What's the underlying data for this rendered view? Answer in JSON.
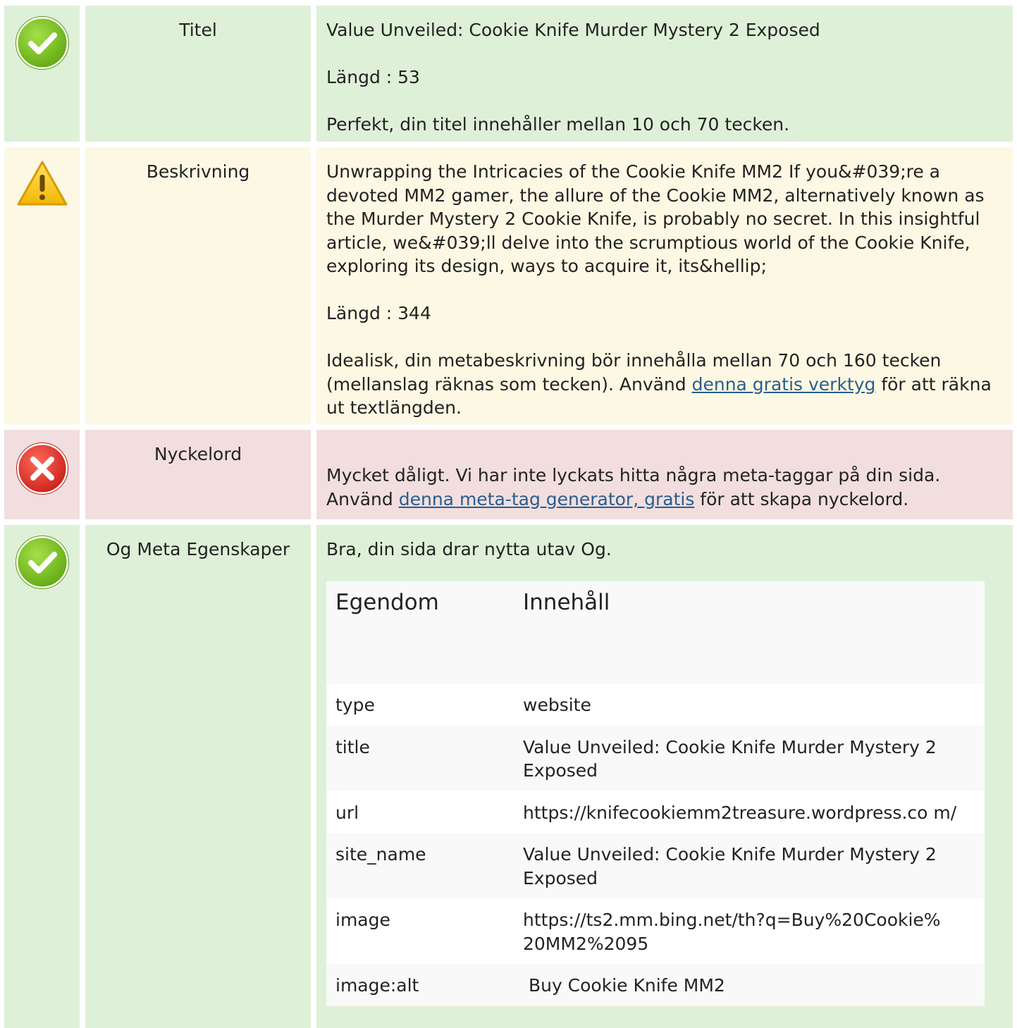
{
  "sections": {
    "title": {
      "label": "Titel",
      "text": "Value Unveiled: Cookie Knife Murder Mystery 2 Exposed",
      "length": "Längd : 53",
      "message": "Perfekt, din titel innehåller mellan 10 och 70 tecken.",
      "status": "ok"
    },
    "description": {
      "label": "Beskrivning",
      "text": "Unwrapping the Intricacies of the Cookie Knife MM2 If you&#039;re a devoted MM2 gamer, the allure of the Cookie MM2, alternatively known as the Murder Mystery 2 Cookie Knife, is probably no secret. In this insightful article, we&#039;ll delve into the scrumptious world of the Cookie Knife, exploring its design, ways to acquire it, its&hellip;",
      "length": "Längd : 344",
      "message_before": "Idealisk, din metabeskrivning bör innehålla mellan 70 och 160 tecken (mellanslag räknas som tecken). Använd ",
      "link_text": "denna gratis verktyg",
      "message_after": " för att räkna ut textlängden.",
      "status": "warning"
    },
    "keywords": {
      "label": "Nyckelord",
      "message_before": "Mycket dåligt. Vi har inte lyckats hitta några meta-taggar på din sida. Använd ",
      "link_text": "denna meta-tag generator, gratis",
      "message_after": " för att skapa nyckelord.",
      "status": "error"
    },
    "og": {
      "label": "Og Meta Egenskaper",
      "message": "Bra, din sida drar nytta utav Og.",
      "status": "ok",
      "table": {
        "headers": [
          "Egendom",
          "Innehåll"
        ],
        "rows": [
          {
            "property": "type",
            "content": "website"
          },
          {
            "property": "title",
            "content": "Value Unveiled: Cookie Knife Murder Mystery 2 Exposed"
          },
          {
            "property": "url",
            "content": "https://knifecookiemm2treasure.wordpress.co m/"
          },
          {
            "property": "site_name",
            "content": "Value Unveiled: Cookie Knife Murder Mystery 2 Exposed"
          },
          {
            "property": "image",
            "content": "https://ts2.mm.bing.net/th?q=Buy%20Cookie% 20MM2%2095"
          },
          {
            "property": "image:alt",
            "content": " Buy Cookie Knife MM2"
          }
        ]
      }
    }
  },
  "colors": {
    "ok_bg": "#dff0d8",
    "warning_bg": "#fcf8e3",
    "error_bg": "#f2dede",
    "link": "#2a5d8e",
    "ok_icon": "#7cc21e",
    "warning_icon": "#f5c518",
    "error_icon": "#e0342c"
  }
}
